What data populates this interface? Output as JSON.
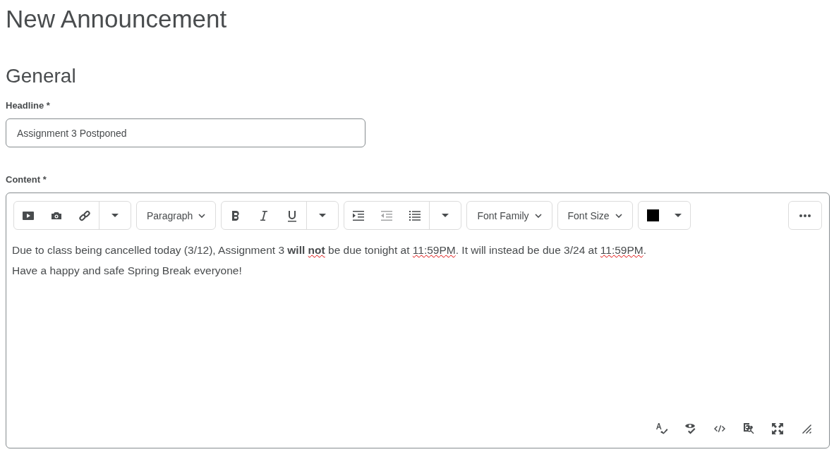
{
  "page_title": "New Announcement",
  "section_title": "General",
  "headline": {
    "label": "Headline *",
    "value": "Assignment 3 Postponed"
  },
  "content": {
    "label": "Content *",
    "toolbar": [
      {
        "kind": "group",
        "items": [
          {
            "kind": "video"
          },
          {
            "kind": "camera"
          },
          {
            "kind": "link"
          },
          {
            "kind": "caret"
          }
        ]
      },
      {
        "kind": "select",
        "label": "Paragraph"
      },
      {
        "kind": "group",
        "items": [
          {
            "kind": "bold"
          },
          {
            "kind": "italic"
          },
          {
            "kind": "underline"
          },
          {
            "kind": "caret"
          }
        ]
      },
      {
        "kind": "group",
        "items": [
          {
            "kind": "indent",
            "disabled": false
          },
          {
            "kind": "outdent",
            "disabled": true
          },
          {
            "kind": "list",
            "disabled": false
          },
          {
            "kind": "caret"
          }
        ]
      },
      {
        "kind": "select",
        "label": "Font Family"
      },
      {
        "kind": "select",
        "label": "Font Size"
      },
      {
        "kind": "color",
        "color": "#000000"
      },
      {
        "kind": "more"
      }
    ],
    "paragraphs": [
      [
        {
          "text": "Due to class being cancelled today (3/12), Assignment 3 ",
          "bold": false,
          "misspelled": false
        },
        {
          "text": "will ",
          "bold": true,
          "misspelled": false
        },
        {
          "text": "not",
          "bold": true,
          "misspelled": true
        },
        {
          "text": " be due tonight at ",
          "bold": false,
          "misspelled": false
        },
        {
          "text": "11:59PM",
          "bold": false,
          "misspelled": true
        },
        {
          "text": ".  It will instead be due 3/24 at ",
          "bold": false,
          "misspelled": false
        },
        {
          "text": "11:59PM",
          "bold": false,
          "misspelled": true
        },
        {
          "text": ".",
          "bold": false,
          "misspelled": false
        }
      ],
      [
        {
          "text": "Have a happy and safe Spring Break everyone!",
          "bold": false,
          "misspelled": false
        }
      ]
    ],
    "footer_tools": [
      {
        "kind": "spellcheck"
      },
      {
        "kind": "accessibility"
      },
      {
        "kind": "source"
      },
      {
        "kind": "preview"
      },
      {
        "kind": "fullscreen"
      },
      {
        "kind": "resize"
      }
    ]
  }
}
